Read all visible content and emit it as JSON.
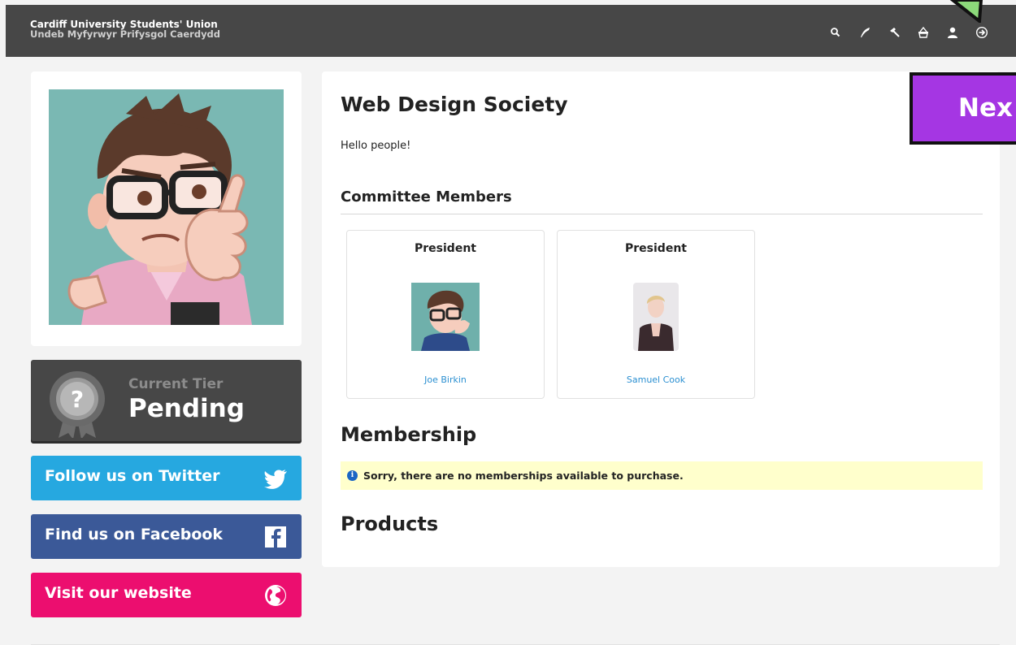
{
  "header": {
    "brand_line1": "Cardiff University Students' Union",
    "brand_line2": "Undeb Myfyrwyr Prifysgol Caerdydd",
    "bg_color": "#474747",
    "icons": [
      "search-icon",
      "quill-icon",
      "gavel-icon",
      "basket-icon",
      "user-icon",
      "sign-in-icon"
    ]
  },
  "sidebar": {
    "tier_label": "Current Tier",
    "tier_value": "Pending",
    "twitter_label": "Follow us on Twitter",
    "facebook_label": "Find us on Facebook",
    "website_label": "Visit our website",
    "colors": {
      "twitter": "#26a8e0",
      "facebook": "#3b5998",
      "website": "#ec0e6f"
    }
  },
  "main": {
    "title": "Web Design Society",
    "intro": "Hello people!",
    "committee_heading": "Committee Members",
    "committee": [
      {
        "role": "President",
        "name": "Joe Birkin"
      },
      {
        "role": "President",
        "name": "Samuel Cook"
      }
    ],
    "membership_heading": "Membership",
    "membership_notice": "Sorry, there are no memberships available to purchase.",
    "products_heading": "Products"
  },
  "overlay": {
    "next_label": "Nex",
    "next_color": "#a536e3"
  }
}
